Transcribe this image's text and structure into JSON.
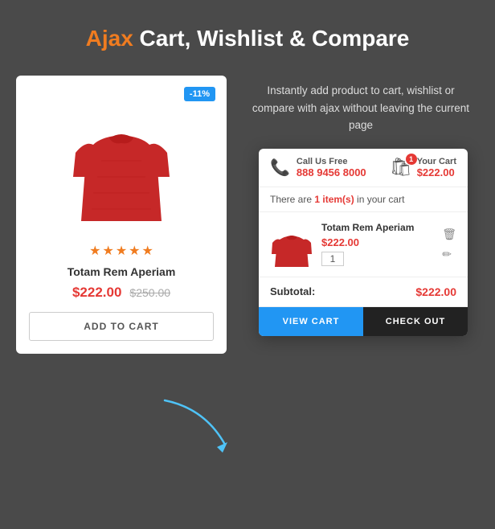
{
  "header": {
    "accent": "Ajax",
    "rest": " Cart, Wishlist & Compare"
  },
  "description": "Instantly add product to cart, wishlist or compare with ajax without leaving the current page",
  "product": {
    "discount": "-11%",
    "name": "Totam Rem Aperiam",
    "price_current": "$222.00",
    "price_old": "$250.00",
    "stars": 5,
    "add_to_cart_label": "ADD TO CART"
  },
  "cart_popup": {
    "call_label": "Call Us Free",
    "call_number": "888 9456 8000",
    "cart_label": "Your Cart",
    "cart_total": "$222.00",
    "cart_badge": "1",
    "items_line_prefix": "There are ",
    "items_count": "1 item(s)",
    "items_line_suffix": " in your cart",
    "item": {
      "name": "Totam Rem Aperiam",
      "price": "$222.00",
      "qty": "1"
    },
    "subtotal_label": "Subtotal:",
    "subtotal_value": "$222.00",
    "view_cart_label": "VIEW CART",
    "checkout_label": "CHECK OUT"
  }
}
